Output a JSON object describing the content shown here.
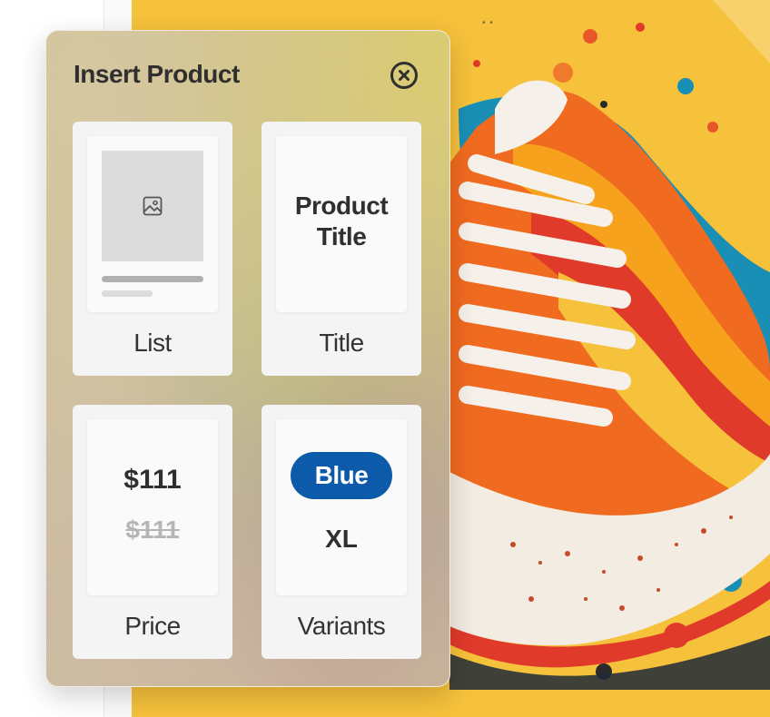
{
  "panel": {
    "title": "Insert Product",
    "close_icon": "close-circle-icon"
  },
  "tiles": [
    {
      "label": "List",
      "preview": {
        "image_icon": "image-icon"
      }
    },
    {
      "label": "Title",
      "preview": {
        "text": "Product Title"
      }
    },
    {
      "label": "Price",
      "preview": {
        "price": "$111",
        "compare_at_price": "$111"
      }
    },
    {
      "label": "Variants",
      "preview": {
        "option": "Blue",
        "size": "XL"
      }
    }
  ],
  "colors": {
    "accent_blue": "#0d5aaa",
    "canvas_yellow": "#f6c13b"
  }
}
